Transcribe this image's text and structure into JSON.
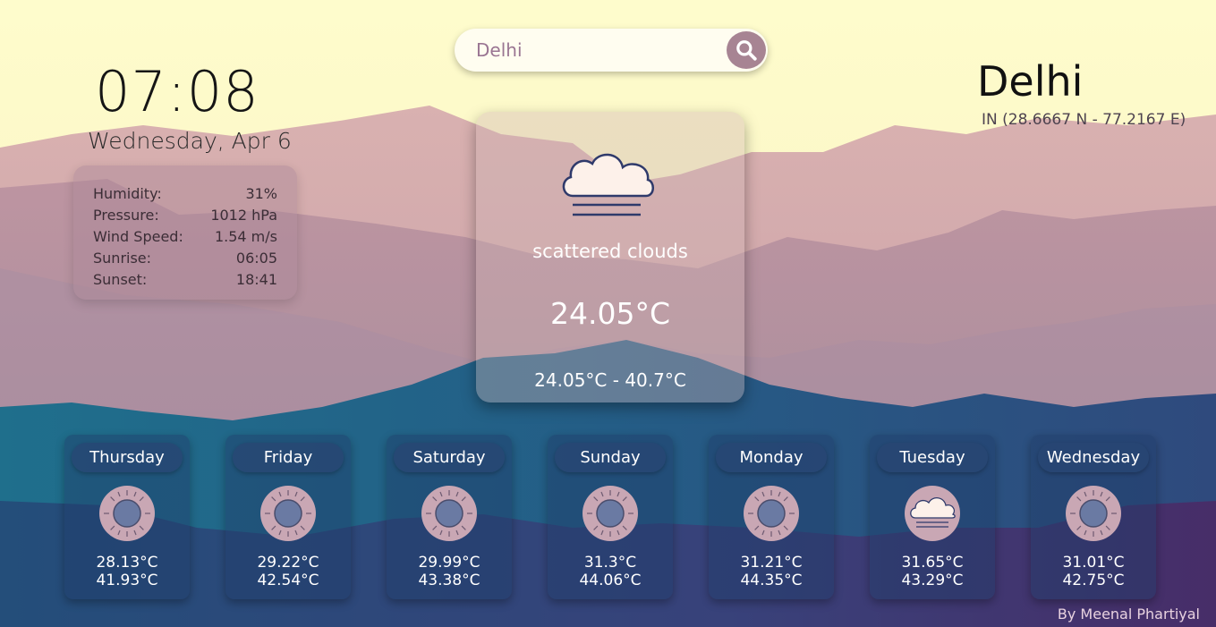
{
  "search": {
    "value": "Delhi",
    "placeholder": ""
  },
  "clock": {
    "time": "07:08",
    "date": "Wednesday, Apr 6"
  },
  "details": [
    {
      "label": "Humidity:",
      "value": "31%"
    },
    {
      "label": "Pressure:",
      "value": "1012 hPa"
    },
    {
      "label": "Wind Speed:",
      "value": "1.54 m/s"
    },
    {
      "label": "Sunrise:",
      "value": "06:05"
    },
    {
      "label": "Sunset:",
      "value": "18:41"
    }
  ],
  "location": {
    "city": "Delhi",
    "coords": "IN (28.6667 N - 77.2167 E)"
  },
  "current": {
    "icon": "cloud-mist-icon",
    "description": "scattered clouds",
    "temp": "24.05°C",
    "range": "24.05°C - 40.7°C"
  },
  "forecast": [
    {
      "day": "Thursday",
      "icon": "sun-icon",
      "low": "28.13°C",
      "high": "41.93°C"
    },
    {
      "day": "Friday",
      "icon": "sun-icon",
      "low": "29.22°C",
      "high": "42.54°C"
    },
    {
      "day": "Saturday",
      "icon": "sun-icon",
      "low": "29.99°C",
      "high": "43.38°C"
    },
    {
      "day": "Sunday",
      "icon": "sun-icon",
      "low": "31.3°C",
      "high": "44.06°C"
    },
    {
      "day": "Monday",
      "icon": "sun-icon",
      "low": "31.21°C",
      "high": "44.35°C"
    },
    {
      "day": "Tuesday",
      "icon": "cloud-icon",
      "low": "31.65°C",
      "high": "43.29°C"
    },
    {
      "day": "Wednesday",
      "icon": "sun-icon",
      "low": "31.01°C",
      "high": "42.75°C"
    }
  ],
  "footer": {
    "credit": "By Meenal Phartiyal"
  },
  "colors": {
    "sky": "#fdf9c9",
    "card": "#aa8796",
    "accent": "#a78493",
    "icon_stroke": "#2f3a6b"
  }
}
